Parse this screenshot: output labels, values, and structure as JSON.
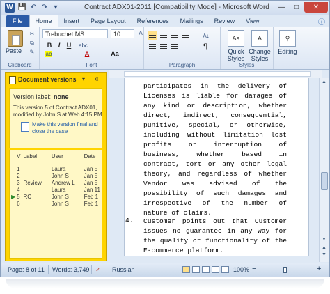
{
  "window": {
    "title": "Contract ADX01-2011 [Compatibility Mode] - Microsoft Word",
    "app_icon": "W",
    "qat_icons": [
      "save-icon",
      "undo-icon",
      "redo-icon",
      "customize-icon"
    ],
    "controls": [
      "minimize",
      "maximize",
      "close"
    ]
  },
  "ribbon": {
    "tabs": [
      "File",
      "Home",
      "Insert",
      "Page Layout",
      "References",
      "Mailings",
      "Review",
      "View"
    ],
    "active_tab": "Home",
    "clipboard": {
      "paste_label": "Paste",
      "group_label": "Clipboard"
    },
    "font": {
      "font_name": "Trebuchet MS",
      "font_size": "10",
      "group_label": "Font",
      "buttons": [
        "B",
        "I",
        "U",
        "A",
        "Aa"
      ]
    },
    "paragraph": {
      "group_label": "Paragraph",
      "pilcrow": "¶"
    },
    "styles": {
      "quick_styles": "Quick Styles",
      "change_styles": "Change Styles",
      "group_label": "Styles"
    },
    "editing": {
      "label": "Editing"
    }
  },
  "pane": {
    "title": "Document versions",
    "version_label_key": "Version label:",
    "version_label_value": "none",
    "version_info": "This version 5 of Contract ADX01, modified by John S at Web 4:15 PM",
    "action_link": "Make this version final and close the case",
    "table": {
      "headers": [
        "V",
        "Label",
        "User",
        "Date"
      ],
      "rows": [
        {
          "v": "1",
          "label": "",
          "user": "Laura",
          "date": "Jan 5",
          "current": false
        },
        {
          "v": "2",
          "label": "",
          "user": "John S",
          "date": "Jan 5",
          "current": false
        },
        {
          "v": "3",
          "label": "Review",
          "user": "Andrew L",
          "date": "Jan 5",
          "current": false
        },
        {
          "v": "4",
          "label": "",
          "user": "Laura",
          "date": "Jan 11",
          "current": false
        },
        {
          "v": "5",
          "label": "RC",
          "user": "John S",
          "date": "Feb 1",
          "current": true
        },
        {
          "v": "6",
          "label": "",
          "user": "John S",
          "date": "Feb 1",
          "current": false
        }
      ]
    }
  },
  "document": {
    "para1": "participates in the delivery of Licenses is liable for damages of any kind or description, whether direct, indirect, consequential, punitive, special, or otherwise, including without limitation lost profits or interruption of business, whether based in contract, tort or any other legal theory, and regardless of whether Vendor was advised of the possibility of such damages and irrespective of the number of nature of claims.",
    "para2_number": "4.",
    "para2": "Customer points out that Customer issues no guarantee in any way for the quality or functionality of the E-commerce platform."
  },
  "status": {
    "page": "Page: 8 of 11",
    "words": "Words: 3,749",
    "language": "Russian",
    "zoom": "100%",
    "zoom_minus": "−",
    "zoom_plus": "+"
  },
  "colors": {
    "pane_yellow": "#ffd400",
    "file_tab": "#2a5aa6",
    "close_button": "#c9463d"
  }
}
